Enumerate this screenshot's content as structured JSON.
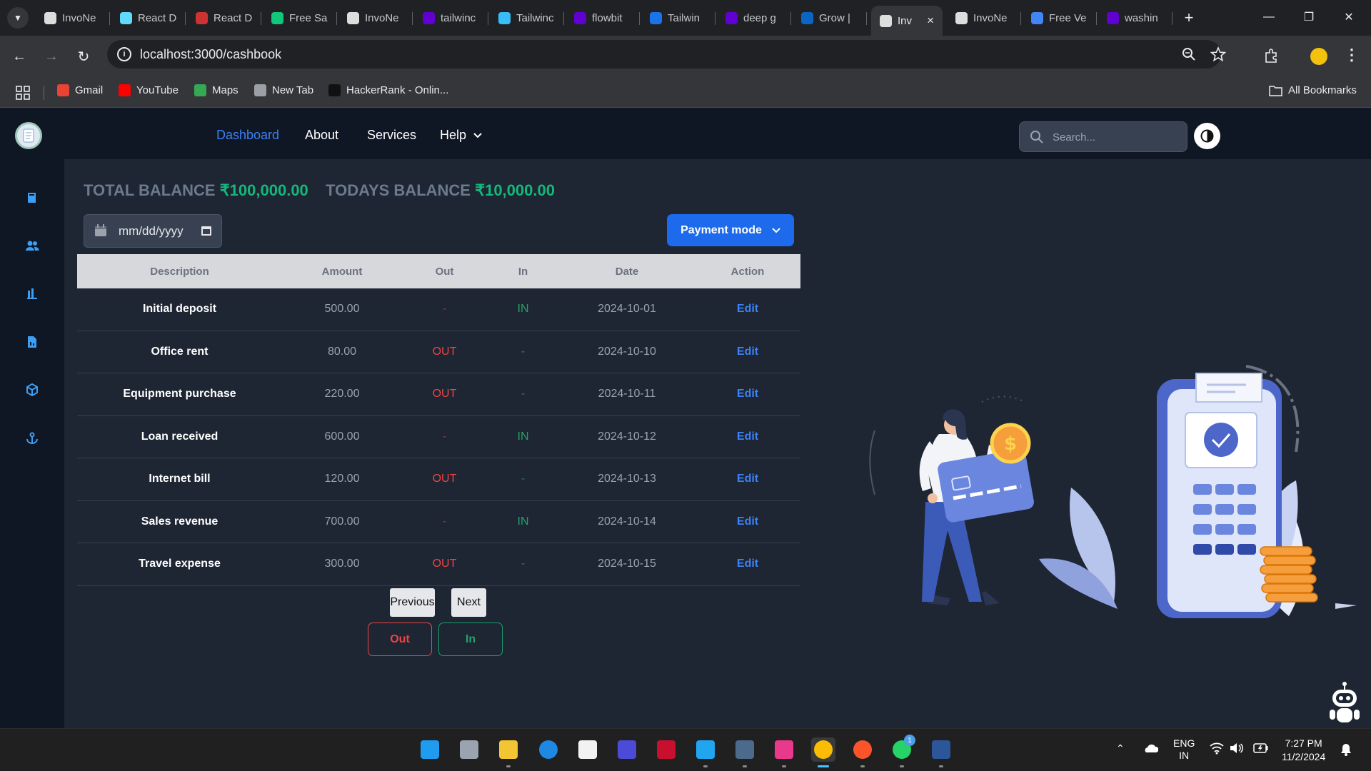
{
  "browser": {
    "tabs": [
      {
        "title": "InvoNe",
        "icon": "invonest-icon",
        "color": "#dddddd"
      },
      {
        "title": "React D",
        "icon": "react-icon",
        "color": "#61dafb"
      },
      {
        "title": "React D",
        "icon": "react-dnd-icon",
        "color": "#cc3333"
      },
      {
        "title": "Free Sa",
        "icon": "freesaas-icon",
        "color": "#10c77a"
      },
      {
        "title": "InvoNe",
        "icon": "invonest-icon",
        "color": "#dddddd"
      },
      {
        "title": "tailwinc",
        "icon": "yahoo-icon",
        "color": "#6001d2"
      },
      {
        "title": "Tailwinc",
        "icon": "tailwind-icon",
        "color": "#38bdf8"
      },
      {
        "title": "flowbit",
        "icon": "yahoo-icon",
        "color": "#6001d2"
      },
      {
        "title": "Tailwin",
        "icon": "tailwind-ui-icon",
        "color": "#1a73e8"
      },
      {
        "title": "deep g",
        "icon": "yahoo-icon",
        "color": "#6001d2"
      },
      {
        "title": "Grow |",
        "icon": "linkedin-icon",
        "color": "#0a66c2"
      },
      {
        "title": "Inv",
        "icon": "invonest-icon",
        "color": "#dddddd",
        "active": true
      },
      {
        "title": "InvoNe",
        "icon": "invonest-icon",
        "color": "#dddddd"
      },
      {
        "title": "Free Ve",
        "icon": "form-icon",
        "color": "#4285f4"
      },
      {
        "title": "washin",
        "icon": "yahoo-icon",
        "color": "#6001d2"
      }
    ],
    "new_tab": "+",
    "url": "localhost:3000/cashbook",
    "bookmarks": [
      {
        "label": "Gmail",
        "icon": "gmail-icon",
        "color": "#ea4335"
      },
      {
        "label": "YouTube",
        "icon": "youtube-icon",
        "color": "#ff0000"
      },
      {
        "label": "Maps",
        "icon": "maps-icon",
        "color": "#34a853"
      },
      {
        "label": "New Tab",
        "icon": "globe-icon",
        "color": "#9aa0a6"
      },
      {
        "label": "HackerRank - Onlin...",
        "icon": "hackerrank-icon",
        "color": "#111111"
      }
    ],
    "all_bookmarks": "All Bookmarks"
  },
  "nav": {
    "items": [
      {
        "label": "Dashboard",
        "active": true
      },
      {
        "label": "About"
      },
      {
        "label": "Services"
      },
      {
        "label": "Help"
      }
    ],
    "search_placeholder": "Search..."
  },
  "sidebar": {
    "icons": [
      "book-icon",
      "users-icon",
      "bar-chart-icon",
      "invoice-icon",
      "cube-icon",
      "anchor-icon"
    ]
  },
  "balance": {
    "total_label": "TOTAL BALANCE",
    "total_value": "₹100,000.00",
    "today_label": "TODAYS BALANCE",
    "today_value": "₹10,000.00"
  },
  "date_filter": {
    "placeholder": "mm/dd/yyyy"
  },
  "payment_mode": {
    "label": "Payment mode"
  },
  "table": {
    "headers": [
      "Description",
      "Amount",
      "Out",
      "In",
      "Date",
      "Action"
    ],
    "rows": [
      {
        "description": "Initial deposit",
        "amount": "500.00",
        "out": "-",
        "in": "IN",
        "date": "2024-10-01",
        "action": "Edit"
      },
      {
        "description": "Office rent",
        "amount": "80.00",
        "out": "OUT",
        "in": "-",
        "date": "2024-10-10",
        "action": "Edit"
      },
      {
        "description": "Equipment purchase",
        "amount": "220.00",
        "out": "OUT",
        "in": "-",
        "date": "2024-10-11",
        "action": "Edit"
      },
      {
        "description": "Loan received",
        "amount": "600.00",
        "out": "-",
        "in": "IN",
        "date": "2024-10-12",
        "action": "Edit"
      },
      {
        "description": "Internet bill",
        "amount": "120.00",
        "out": "OUT",
        "in": "-",
        "date": "2024-10-13",
        "action": "Edit"
      },
      {
        "description": "Sales revenue",
        "amount": "700.00",
        "out": "-",
        "in": "IN",
        "date": "2024-10-14",
        "action": "Edit"
      },
      {
        "description": "Travel expense",
        "amount": "300.00",
        "out": "OUT",
        "in": "-",
        "date": "2024-10-15",
        "action": "Edit"
      }
    ]
  },
  "pagination": {
    "previous": "Previous",
    "next": "Next"
  },
  "actions": {
    "out": "Out",
    "in": "In"
  },
  "taskbar": {
    "apps": [
      "windows-start-icon",
      "task-view-icon",
      "file-explorer-icon",
      "edge-icon",
      "store-icon",
      "app-icon",
      "mcafee-icon",
      "vscode-icon",
      "mysql-workbench-icon",
      "intellij-icon",
      "chrome-icon",
      "brave-icon",
      "whatsapp-icon",
      "word-icon"
    ],
    "whatsapp_badge": "1",
    "lang": "ENG",
    "region": "IN",
    "time": "7:27 PM",
    "date": "11/2/2024"
  },
  "colors": {
    "accent": "#3b82f6",
    "in": "#22a36b",
    "out": "#ef4444",
    "balance": "#14b87a",
    "primary_button": "#1d6aec"
  }
}
